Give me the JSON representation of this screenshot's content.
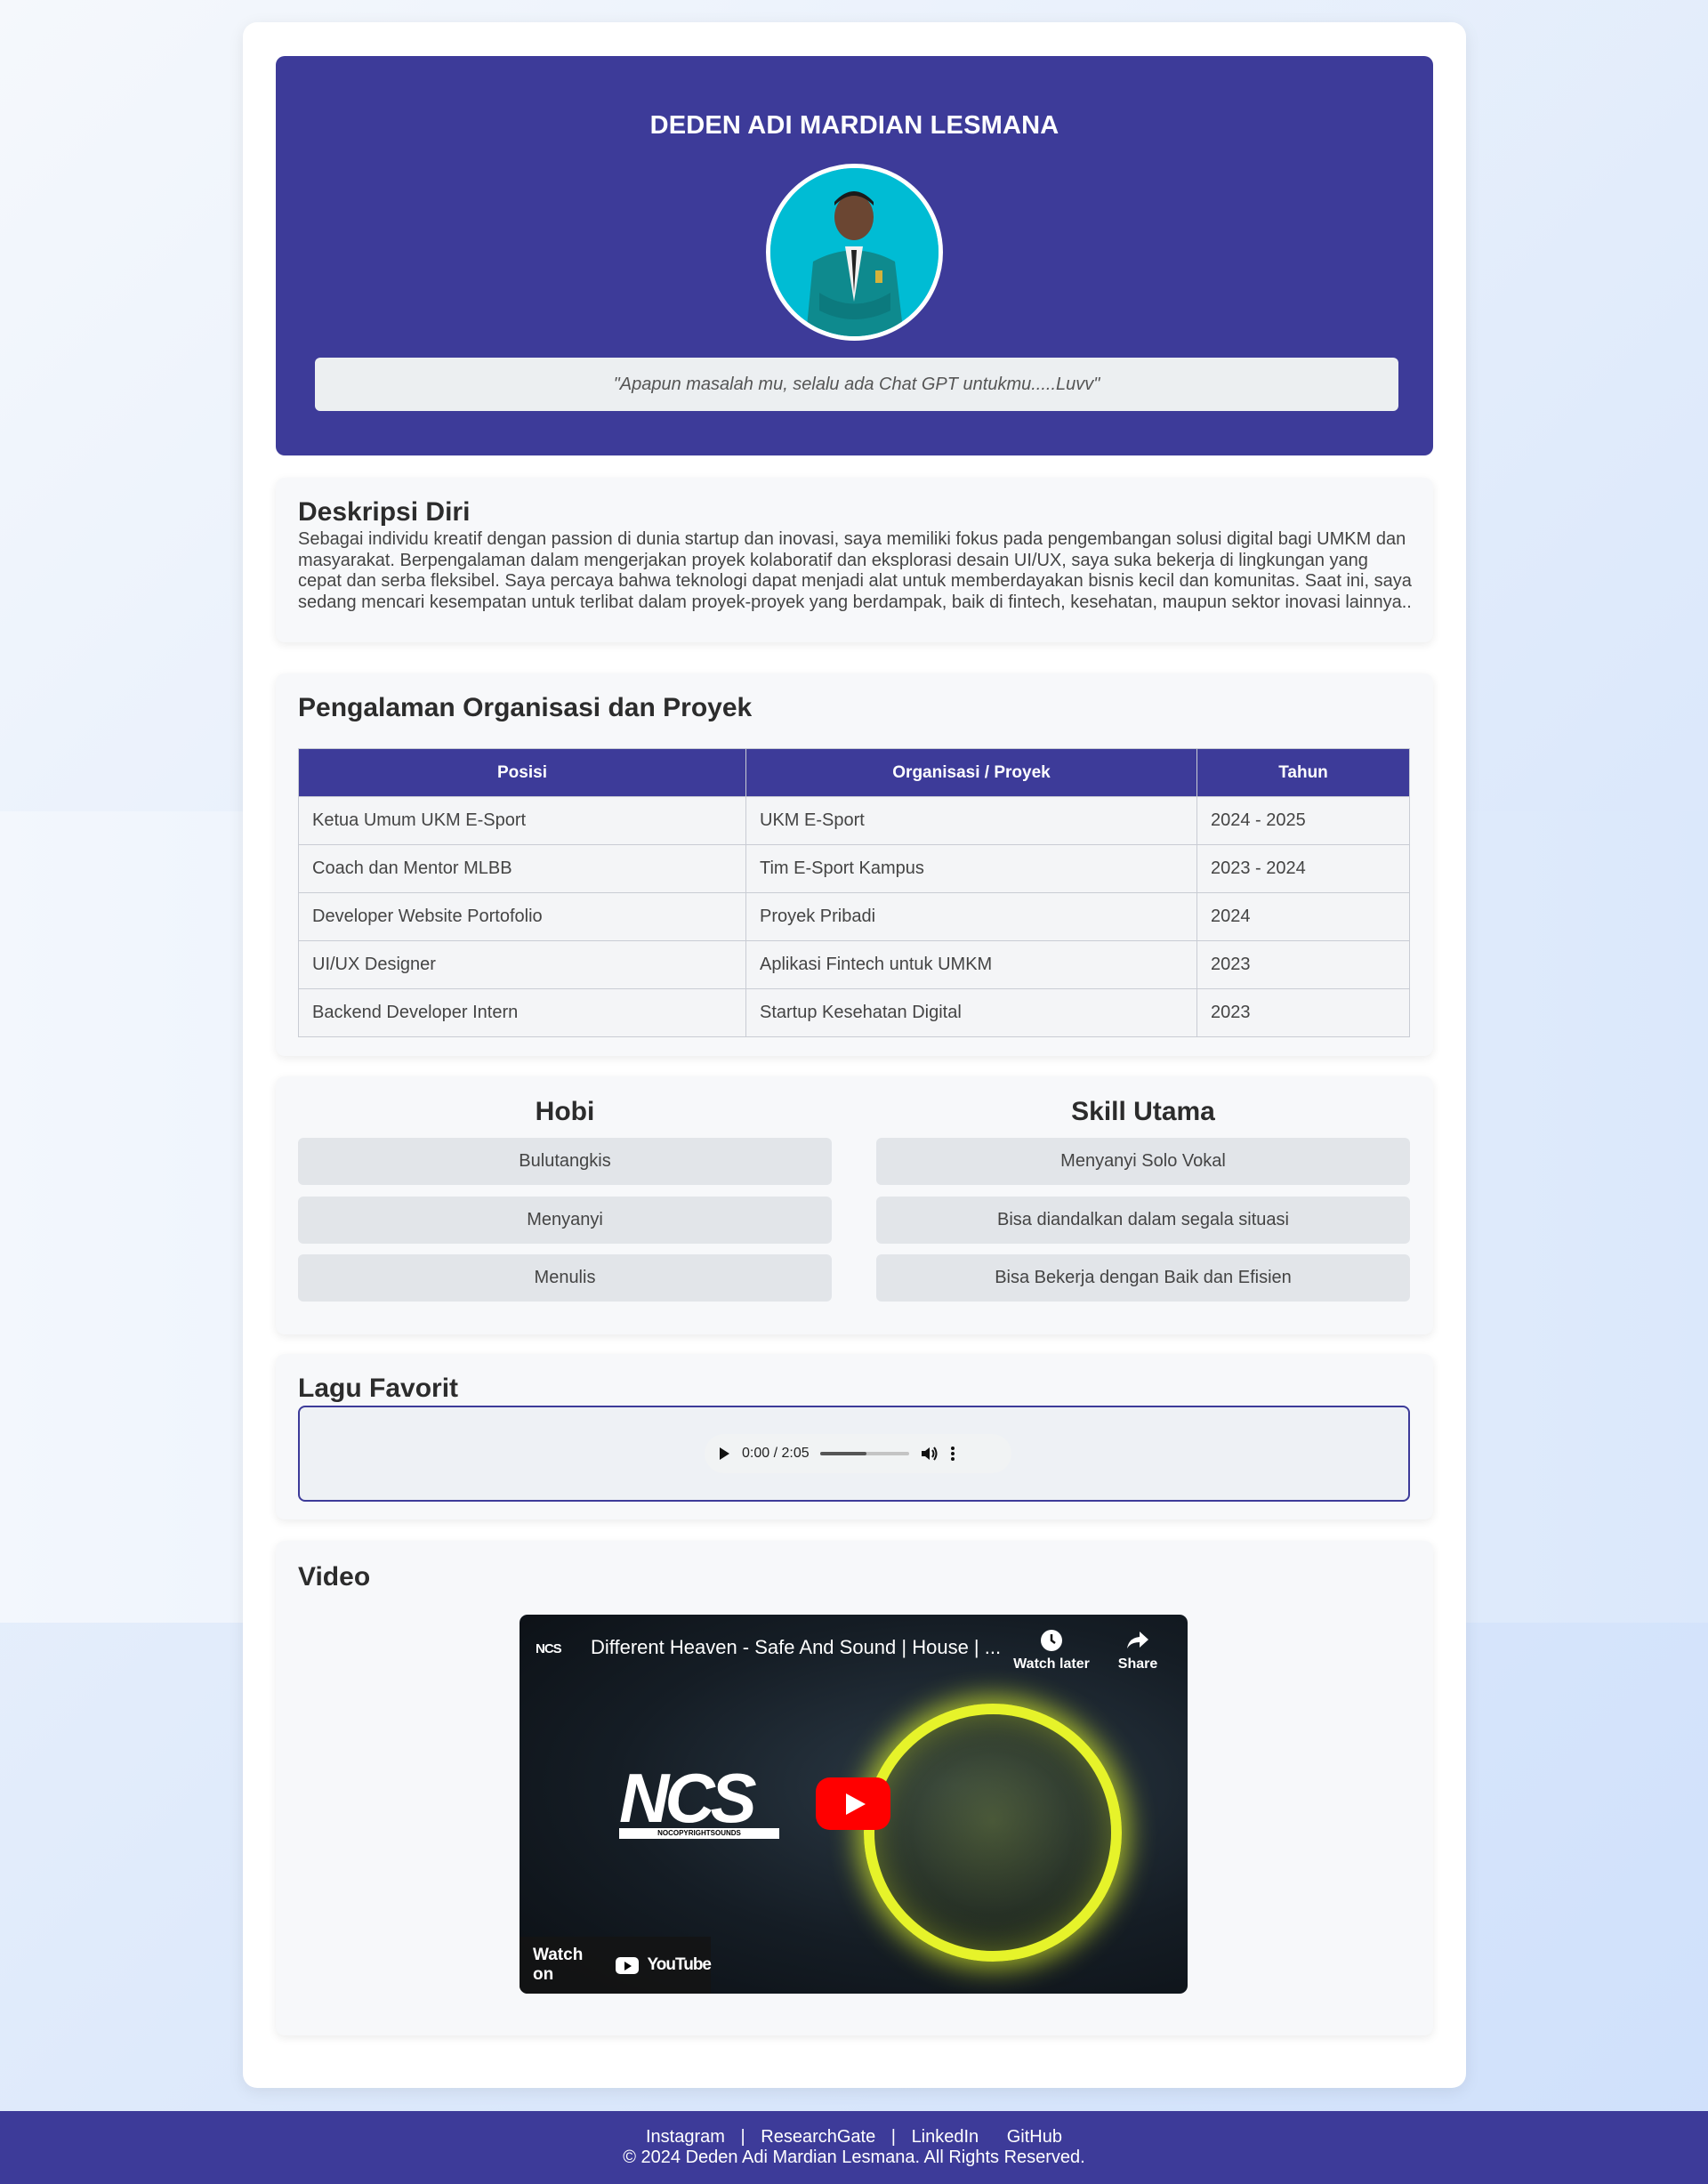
{
  "profile": {
    "name": "DEDEN ADI MARDIAN LESMANA",
    "quote": "\"Apapun masalah mu, selalu ada Chat GPT untukmu.....Luvv\""
  },
  "description": {
    "heading": "Deskripsi Diri",
    "text": "Sebagai individu kreatif dengan passion di dunia startup dan inovasi, saya memiliki fokus pada pengembangan solusi digital bagi UMKM dan masyarakat. Berpengalaman dalam mengerjakan proyek kolaboratif dan eksplorasi desain UI/UX, saya suka bekerja di lingkungan yang cepat dan serba fleksibel. Saya percaya bahwa teknologi dapat menjadi alat untuk memberdayakan bisnis kecil dan komunitas. Saat ini, saya sedang mencari kesempatan untuk terlibat dalam proyek-proyek yang berdampak, baik di fintech, kesehatan, maupun sektor inovasi lainnya.."
  },
  "experience": {
    "heading": "Pengalaman Organisasi dan Proyek",
    "columns": [
      "Posisi",
      "Organisasi / Proyek",
      "Tahun"
    ],
    "rows": [
      [
        "Ketua Umum UKM E-Sport",
        "UKM E-Sport",
        "2024 - 2025"
      ],
      [
        "Coach dan Mentor MLBB",
        "Tim E-Sport Kampus",
        "2023 - 2024"
      ],
      [
        "Developer Website Portofolio",
        "Proyek Pribadi",
        "2024"
      ],
      [
        "UI/UX Designer",
        "Aplikasi Fintech untuk UMKM",
        "2023"
      ],
      [
        "Backend Developer Intern",
        "Startup Kesehatan Digital",
        "2023"
      ]
    ]
  },
  "hobbies": {
    "heading": "Hobi",
    "items": [
      "Bulutangkis",
      "Menyanyi",
      "Menulis"
    ]
  },
  "skills": {
    "heading": "Skill Utama",
    "items": [
      "Menyanyi Solo Vokal",
      "Bisa diandalkan dalam segala situasi",
      "Bisa Bekerja dengan Baik dan Efisien"
    ]
  },
  "song": {
    "heading": "Lagu Favorit",
    "time": "0:00 / 2:05",
    "progress": 0.52
  },
  "video": {
    "heading": "Video",
    "channel_badge": "NCS",
    "title": "Different Heaven - Safe And Sound | House | ...",
    "watch_later": "Watch later",
    "share": "Share",
    "logo_text": "NCS",
    "logo_sub": "NOCOPYRIGHTSOUNDS",
    "watch_on": "Watch on",
    "youtube": "YouTube"
  },
  "footer": {
    "links": [
      "Instagram",
      "ResearchGate",
      "LinkedIn",
      "GitHub"
    ],
    "separator": "|",
    "copyright": "© 2024 Deden Adi Mardian Lesmana. All Rights Reserved."
  },
  "colors": {
    "primary": "#3d3b99",
    "accent_video": "#e6f32a",
    "youtube_red": "#ff0000"
  },
  "icons": [
    "play-icon",
    "volume-icon",
    "more-options-icon",
    "clock-icon",
    "share-icon",
    "youtube-play-icon"
  ]
}
